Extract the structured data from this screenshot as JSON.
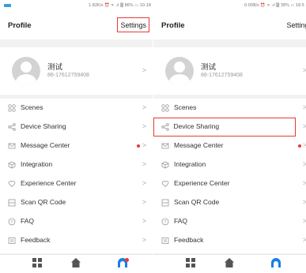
{
  "screens": [
    {
      "status_text": "1.82K/s ⏰ ᯤ .ıl ▒ 86% ▭ 10:18",
      "header": {
        "title": "Profile",
        "settings_label": "Settings"
      },
      "user": {
        "name": "测试",
        "phone": "86-17612759408"
      },
      "menu": [
        {
          "label": "Scenes",
          "icon": "scenes-icon"
        },
        {
          "label": "Device Sharing",
          "icon": "share-icon"
        },
        {
          "label": "Message Center",
          "icon": "message-icon",
          "badge": true
        },
        {
          "label": "Integration",
          "icon": "integration-icon"
        },
        {
          "label": "Experience Center",
          "icon": "heart-icon"
        },
        {
          "label": "Scan QR Code",
          "icon": "scan-icon"
        },
        {
          "label": "FAQ",
          "icon": "help-icon"
        },
        {
          "label": "Feedback",
          "icon": "feedback-icon"
        }
      ],
      "highlight": "settings-button"
    },
    {
      "status_text": "0.00B/s ⏰ ᯤ .ıl ▒ 38% ▭ 16:5",
      "header": {
        "title": "Profile",
        "settings_label": "Settings"
      },
      "user": {
        "name": "测试",
        "phone": "86-17612759408"
      },
      "menu": [
        {
          "label": "Scenes",
          "icon": "scenes-icon"
        },
        {
          "label": "Device Sharing",
          "icon": "share-icon"
        },
        {
          "label": "Message Center",
          "icon": "message-icon",
          "badge": true
        },
        {
          "label": "Integration",
          "icon": "integration-icon"
        },
        {
          "label": "Experience Center",
          "icon": "heart-icon"
        },
        {
          "label": "Scan QR Code",
          "icon": "scan-icon"
        },
        {
          "label": "FAQ",
          "icon": "help-icon"
        },
        {
          "label": "Feedback",
          "icon": "feedback-icon"
        }
      ],
      "highlight": "device-sharing-item"
    }
  ],
  "chevron": ">",
  "colors": {
    "highlight": "#e53935",
    "accent": "#1a7ee6",
    "badge": "#e53935"
  }
}
